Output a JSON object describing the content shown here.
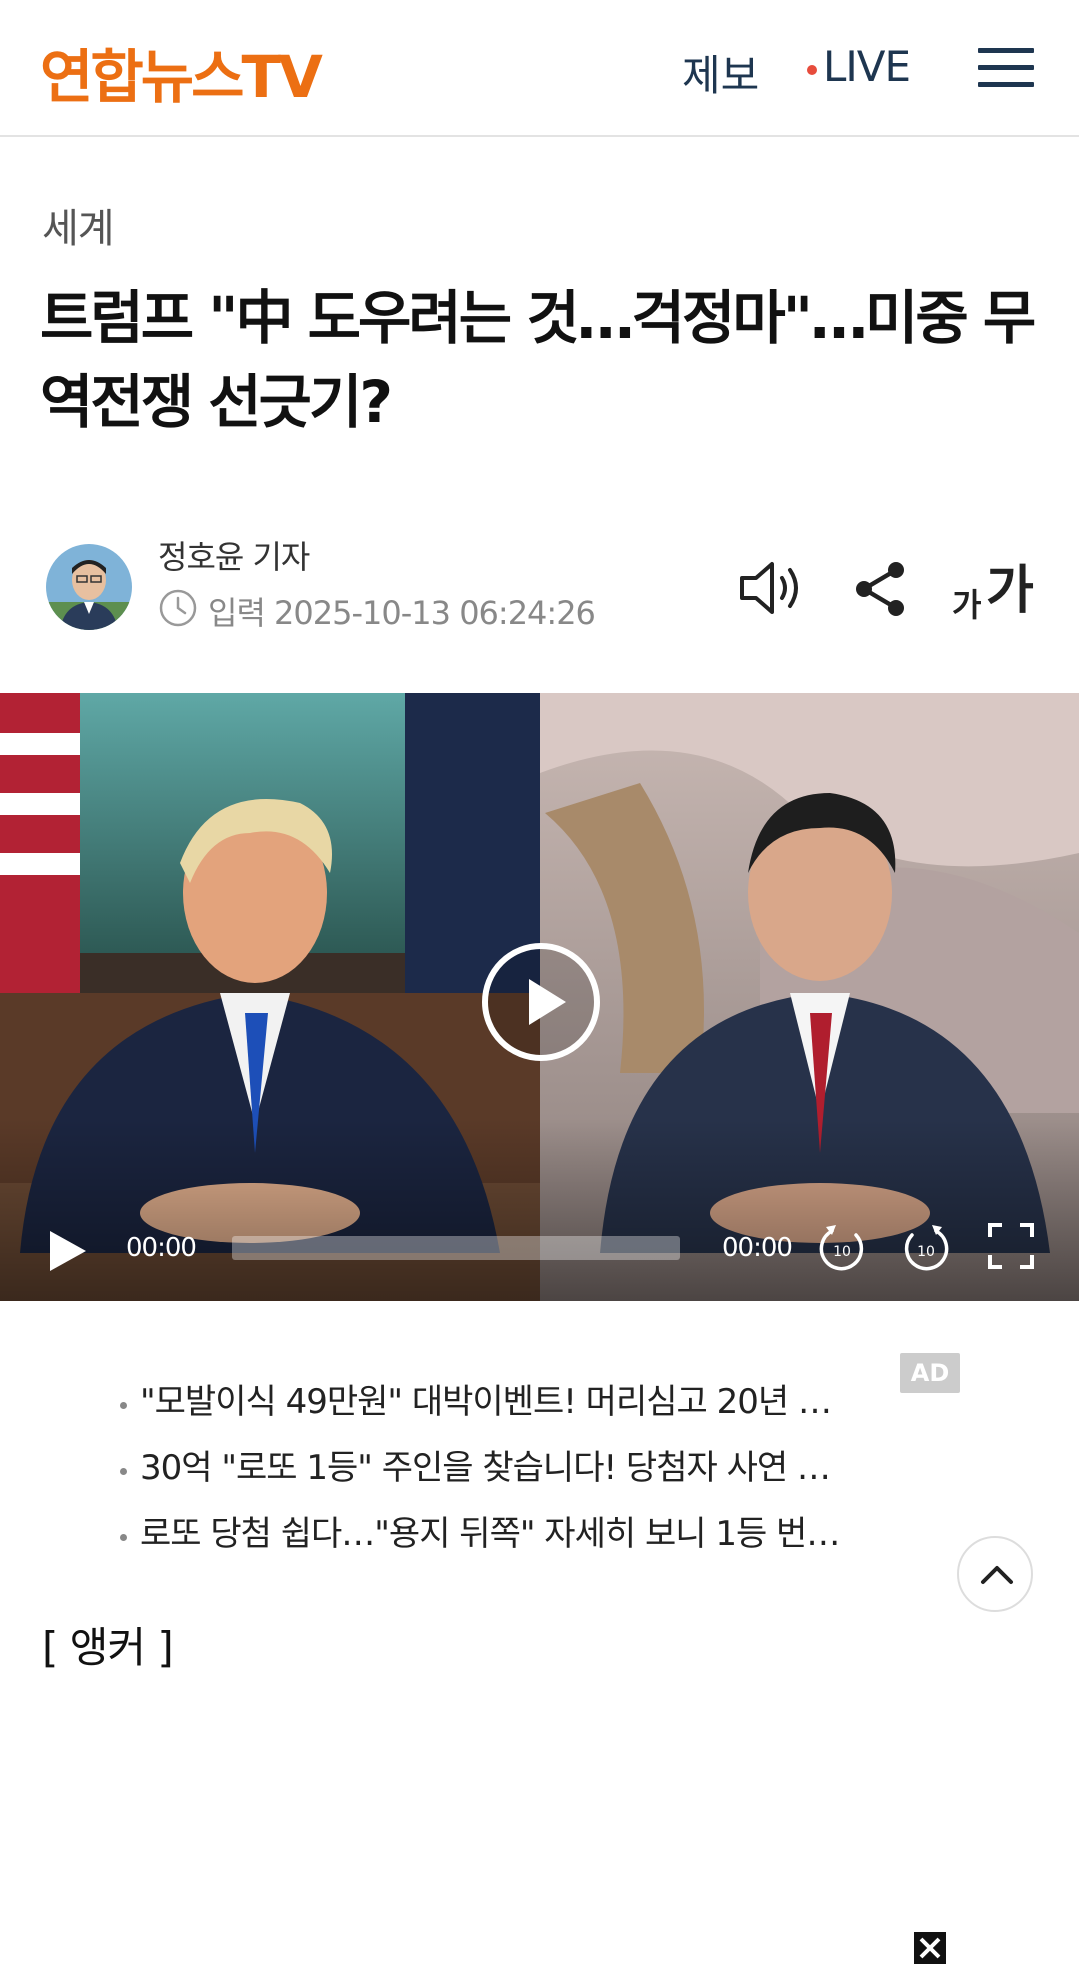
{
  "header": {
    "logo": "연합뉴스TV",
    "tip_label": "제보",
    "live_label": "LIVE",
    "accent_color": "#ec6f13",
    "nav_color": "#1e3650"
  },
  "article": {
    "category": "세계",
    "headline": "트럼프 \"中 도우려는 것…걱정마\"…미중 무역전쟁 선긋기?",
    "reporter": "정호윤 기자",
    "published": "입력 2025-10-13 06:24:26",
    "font_size_small": "가",
    "font_size_big": "가"
  },
  "video": {
    "time_current": "00:00",
    "time_total": "00:00",
    "rewind_seconds": "10",
    "forward_seconds": "10",
    "progress": 0
  },
  "ads": {
    "badge": "AD",
    "items": [
      "\"모발이식 49만원\" 대박이벤트! 머리심고 20년 …",
      "30억 \"로또 1등\" 주인을 찾습니다! 당첨자 사연 …",
      "로또 당첨 쉽다…\"용지 뒤쪽\" 자세히 보니 1등 번…"
    ]
  },
  "body": {
    "anchor_label": "[ 앵커 ]"
  },
  "icons": [
    "menu-icon",
    "clock-icon",
    "speaker-icon",
    "share-icon",
    "play-icon",
    "rewind-icon",
    "forward-icon",
    "fullscreen-icon",
    "chevron-up-icon",
    "close-icon"
  ]
}
